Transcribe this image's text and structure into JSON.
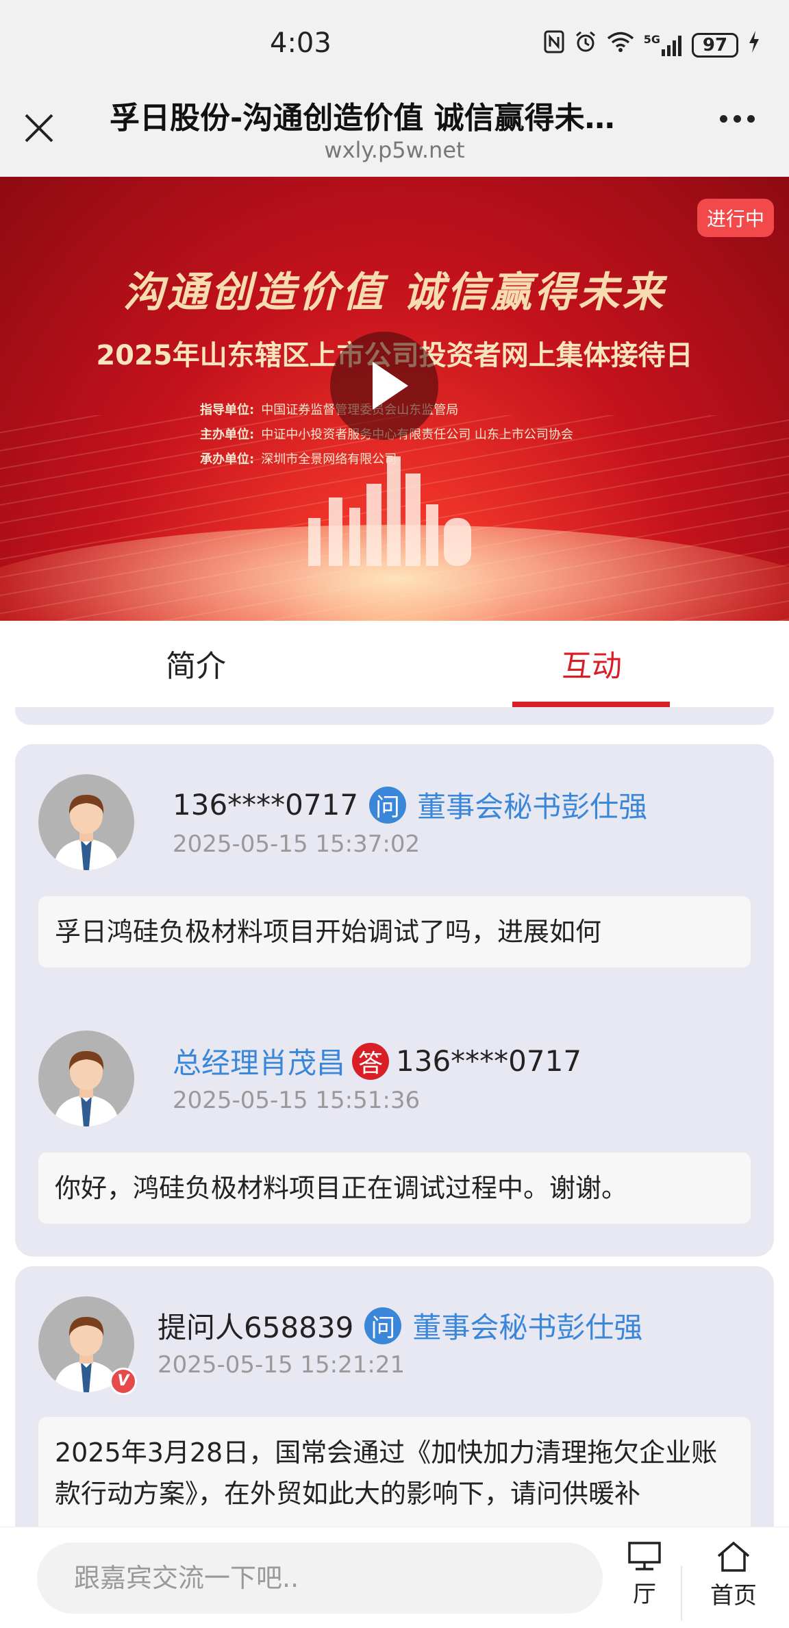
{
  "status_bar": {
    "time": "4:03",
    "network": "5G",
    "battery": "97"
  },
  "header": {
    "title": "孚日股份-沟通创造价值 诚信赢得未…",
    "url": "wxly.p5w.net"
  },
  "banner": {
    "live_badge": "进行中",
    "slogan": "沟通创造价值  诚信赢得未来",
    "headline": "2025年山东辖区上市公司投资者网上集体接待日",
    "orgs": [
      {
        "label": "指导单位:",
        "value": "中国证券监督管理委员会山东监管局"
      },
      {
        "label": "主办单位:",
        "value": "中证中小投资者服务中心有限责任公司  山东上市公司协会"
      },
      {
        "label": "承办单位:",
        "value": "深圳市全景网络有限公司"
      }
    ]
  },
  "tabs": {
    "intro": "简介",
    "interact": "互动"
  },
  "posts": [
    {
      "user": "136****0717",
      "ask_icon": "问",
      "target": "董事会秘书彭仕强",
      "time": "2025-05-15 15:37:02",
      "text": "孚日鸿硅负极材料项目开始调试了吗，进展如何",
      "reply": {
        "responder": "总经理肖茂昌",
        "answer_icon": "答",
        "to": "136****0717",
        "time": "2025-05-15 15:51:36",
        "text": "你好，鸿硅负极材料项目正在调试过程中。谢谢。"
      }
    },
    {
      "user": "提问人658839",
      "ask_icon": "问",
      "target": "董事会秘书彭仕强",
      "time": "2025-05-15 15:21:21",
      "text": "2025年3月28日，国常会通过《加快加力清理拖欠企业账款行动方案》，在外贸如此大的影响下，请问供暖补",
      "verified_badge": "V"
    }
  ],
  "bottom_bar": {
    "input_placeholder": "跟嘉宾交流一下吧..",
    "hall_label": "厅",
    "home_label": "首页"
  },
  "colors": {
    "accent_red": "#d81f26",
    "link_blue": "#3a86d8",
    "card_bg": "#e8e8f2"
  }
}
